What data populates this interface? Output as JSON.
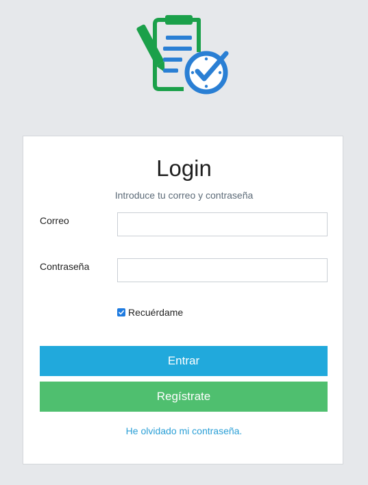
{
  "login": {
    "title": "Login",
    "subtitle": "Introduce tu correo y contraseña",
    "email_label": "Correo",
    "email_value": "",
    "password_label": "Contraseña",
    "password_value": "",
    "remember_label": "Recuérdame",
    "remember_checked": true,
    "enter_button": "Entrar",
    "register_button": "Regístrate",
    "forgot_link": "He olvidado mi contraseña."
  },
  "icons": {
    "logo": "clipboard-checklist-clock-icon",
    "checkbox": "check-icon"
  },
  "colors": {
    "background": "#e6e8eb",
    "logo_green": "#1ba04a",
    "logo_blue": "#2a7fd4",
    "enter_button": "#21a9dc",
    "register_button": "#4fbf6f",
    "link": "#2a9fd6"
  }
}
